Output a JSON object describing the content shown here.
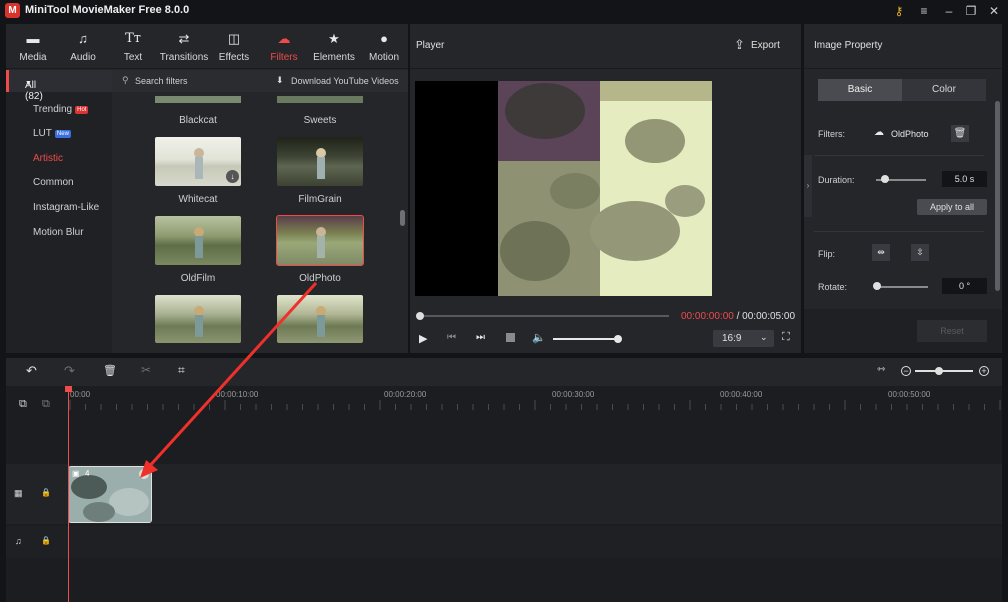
{
  "app": {
    "title": "MiniTool MovieMaker Free 8.0.0",
    "logo_letter": "M"
  },
  "toolbar": {
    "items": [
      {
        "label": "Media",
        "icon": "folder-icon"
      },
      {
        "label": "Audio",
        "icon": "music-note-icon"
      },
      {
        "label": "Text",
        "icon": "text-icon"
      },
      {
        "label": "Transitions",
        "icon": "transitions-icon"
      },
      {
        "label": "Effects",
        "icon": "effects-icon"
      },
      {
        "label": "Filters",
        "icon": "filters-icon",
        "active": true
      },
      {
        "label": "Elements",
        "icon": "elements-icon"
      },
      {
        "label": "Motion",
        "icon": "motion-icon"
      }
    ]
  },
  "sidebar": {
    "header": "All (82)",
    "items": [
      {
        "label": "Trending",
        "badge": "Hot"
      },
      {
        "label": "LUT",
        "badge": "New"
      },
      {
        "label": "Artistic",
        "active": true
      },
      {
        "label": "Common"
      },
      {
        "label": "Instagram-Like"
      },
      {
        "label": "Motion Blur"
      }
    ]
  },
  "filters": {
    "search_placeholder": "Search filters",
    "download_label": "Download YouTube Videos",
    "items": [
      {
        "name": "Blackcat"
      },
      {
        "name": "Sweets"
      },
      {
        "name": "Whitecat"
      },
      {
        "name": "FilmGrain"
      },
      {
        "name": "OldFilm"
      },
      {
        "name": "OldPhoto",
        "selected": true
      }
    ]
  },
  "player": {
    "title": "Player",
    "export_label": "Export",
    "current_time": "00:00:00:00",
    "separator": " / ",
    "total_time": "00:00:05:00",
    "aspect": "16:9"
  },
  "property": {
    "title": "Image Property",
    "tabs": [
      "Basic",
      "Color"
    ],
    "filters_label": "Filters:",
    "filter_value": "OldPhoto",
    "duration_label": "Duration:",
    "duration_value": "5.0 s",
    "apply_all": "Apply to all",
    "flip_label": "Flip:",
    "rotate_label": "Rotate:",
    "rotate_value": "0 °",
    "reset_label": "Reset"
  },
  "timeline": {
    "ticks": [
      "00:00",
      "00:00:10:00",
      "00:00:20:00",
      "00:00:30:00",
      "00:00:40:00",
      "00:00:50:00"
    ],
    "clip_count": "4"
  },
  "colors": {
    "accent": "#ef4b4b",
    "panel": "#25262a",
    "background": "#131417"
  }
}
